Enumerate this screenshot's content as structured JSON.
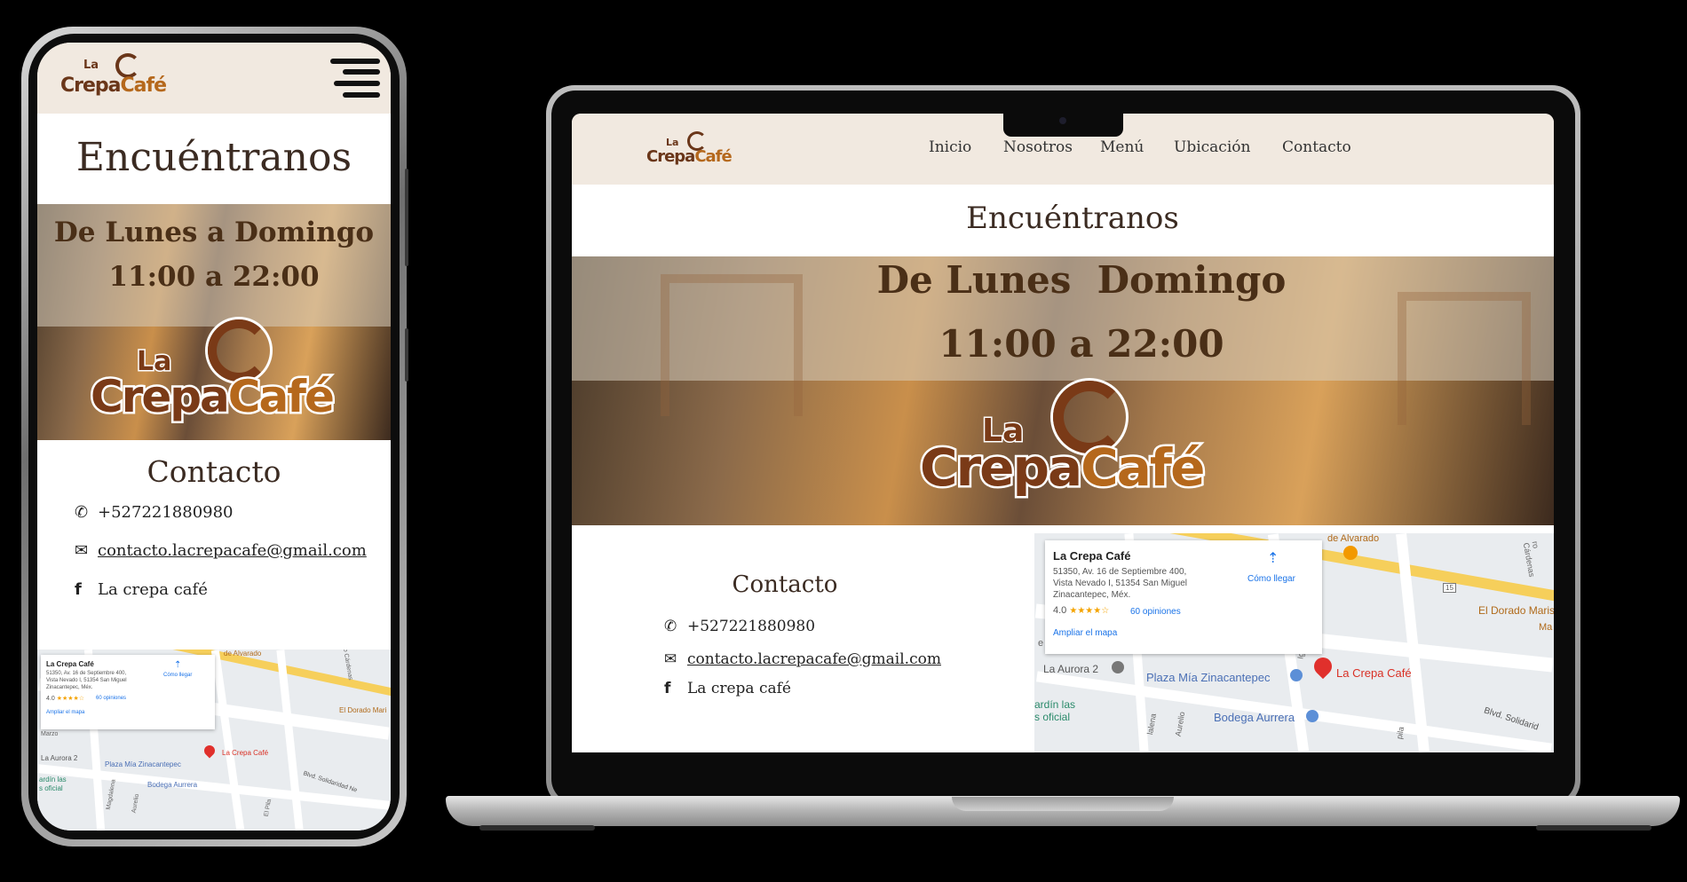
{
  "brand": {
    "logo_la": "La",
    "logo_crepa": "Crepa",
    "logo_cafe": "Café",
    "colors": {
      "brown": "#6a3619",
      "orange": "#b5681c",
      "header_bg": "#f1e9e0"
    }
  },
  "nav": {
    "items": [
      "Inicio",
      "Nosotros",
      "Menú",
      "Ubicación",
      "Contacto"
    ],
    "menu_icon": "hamburger-icon"
  },
  "find_us": {
    "title": "Encuéntranos",
    "days_mobile": "De Lunes a Domingo",
    "days_desktop": "De Lunes  Domingo",
    "hours": "11:00 a 22:00"
  },
  "contact": {
    "title": "Contacto",
    "phone": "+527221880980",
    "email": "contacto.lacrepacafe@gmail.com",
    "facebook": "La crepa café",
    "icons": {
      "phone": "phone-icon",
      "email": "envelope-icon",
      "facebook": "facebook-icon"
    }
  },
  "map": {
    "place_name": "La Crepa Café",
    "address_desktop": [
      "51350, Av. 16 de Septiembre 400,",
      "Vista Nevado I, 51354 San Miguel",
      "Zinacantepec, Méx."
    ],
    "address_mobile": [
      "51350, Av. 16 de Septiembre 400,",
      "Vista Nevado I, 51354 San Miguel",
      "Zinacantepec, Méx."
    ],
    "rating": "4.0",
    "stars": "★★★★☆",
    "reviews": "60 opiniones",
    "directions": "Cómo llegar",
    "enlarge": "Ampliar el mapa",
    "labels_desktop": {
      "alvarado": "de Alvarado",
      "cardenas": "ro Cárdenas",
      "dorado": "El Dorado Mariscal",
      "ma": "Ma",
      "marzo": "e Marzo",
      "aurora": "La Aurora 2",
      "plaza": "Plaza Mía Zinacantepec",
      "pin": "La Crepa Café",
      "jardin1": "ardín las",
      "jardin2": "s oficial",
      "bodega": "Bodega Aurrera",
      "solidaridad": "Blvd. Solidarid",
      "route": "15",
      "madera": "lalena",
      "aurelio": "Aurelio",
      "pila": "pila",
      "igna": "Igna"
    },
    "labels_mobile": {
      "alvarado": "de Alvarado",
      "cardenas": "ro Cárdenas",
      "dorado": "El Dorado Mari",
      "marzo": "Marzo",
      "aurora": "La Aurora 2",
      "plaza": "Plaza Mía Zinacantepec",
      "pin": "La Crepa Café",
      "jardin1": "ardín las",
      "jardin2": "s oficial",
      "bodega": "Bodega Aurrera",
      "solidaridad": "Blvd. Solidaridad Ne",
      "magdalena": "Magdalena",
      "aurelio": "Aurelio",
      "pila": "El Pila"
    }
  }
}
